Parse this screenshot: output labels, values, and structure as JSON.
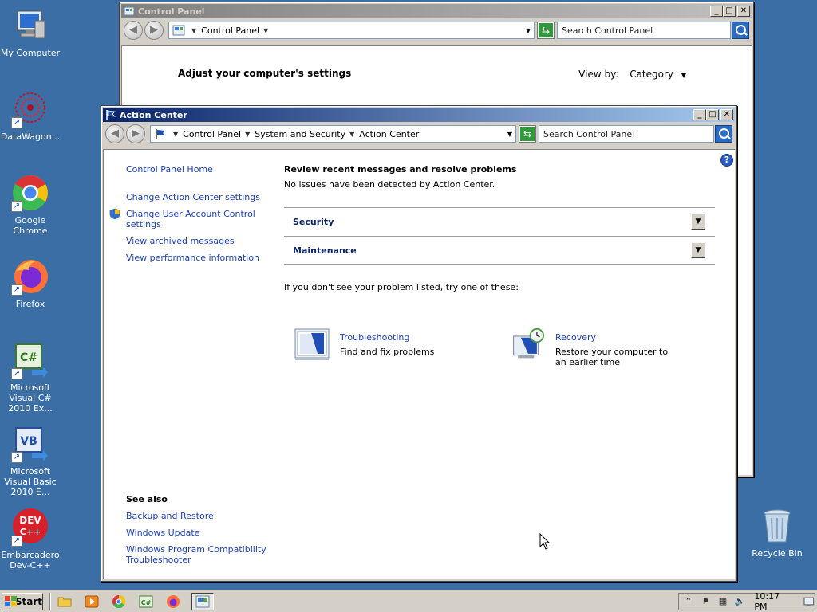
{
  "desktop": {
    "icons": [
      {
        "label": "My Computer"
      },
      {
        "label": "DataWagon..."
      },
      {
        "label": "Google Chrome"
      },
      {
        "label": "Firefox"
      },
      {
        "label": "Microsoft Visual C# 2010 Ex..."
      },
      {
        "label": "Microsoft Visual Basic 2010 E..."
      },
      {
        "label": "Embarcadero Dev-C++"
      }
    ],
    "recycle_bin": {
      "label": "Recycle Bin"
    }
  },
  "control_panel_window": {
    "title": "Control Panel",
    "address": {
      "crumb": "Control Panel"
    },
    "search_placeholder": "Search Control Panel",
    "heading": "Adjust your computer's settings",
    "view_by_label": "View by:",
    "view_by_value": "Category"
  },
  "action_center_window": {
    "title": "Action Center",
    "address": {
      "crumbs": [
        "Control Panel",
        "System and Security",
        "Action Center"
      ]
    },
    "search_placeholder": "Search Control Panel",
    "left_nav": {
      "home": "Control Panel Home",
      "change_ac": "Change Action Center settings",
      "uac": "Change User Account Control settings",
      "archived": "View archived messages",
      "performance": "View performance information"
    },
    "see_also": {
      "title": "See also",
      "links": [
        "Backup and Restore",
        "Windows Update",
        "Windows Program Compatibility Troubleshooter"
      ]
    },
    "main": {
      "title": "Review recent messages and resolve problems",
      "status": "No issues have been detected by Action Center.",
      "sections": [
        "Security",
        "Maintenance"
      ],
      "try_text": "If you don't see your problem listed, try one of these:",
      "tools": [
        {
          "title": "Troubleshooting",
          "desc": "Find and fix problems"
        },
        {
          "title": "Recovery",
          "desc": "Restore your computer to an earlier time"
        }
      ]
    }
  },
  "taskbar": {
    "start_label": "Start",
    "clock": "10:17 PM"
  },
  "colors": {
    "desktop": "#3a6ea5",
    "link": "#1a3fb3",
    "section_heading": "#0c2460",
    "active_title_start": "#0a246a",
    "active_title_end": "#a6caf0"
  }
}
